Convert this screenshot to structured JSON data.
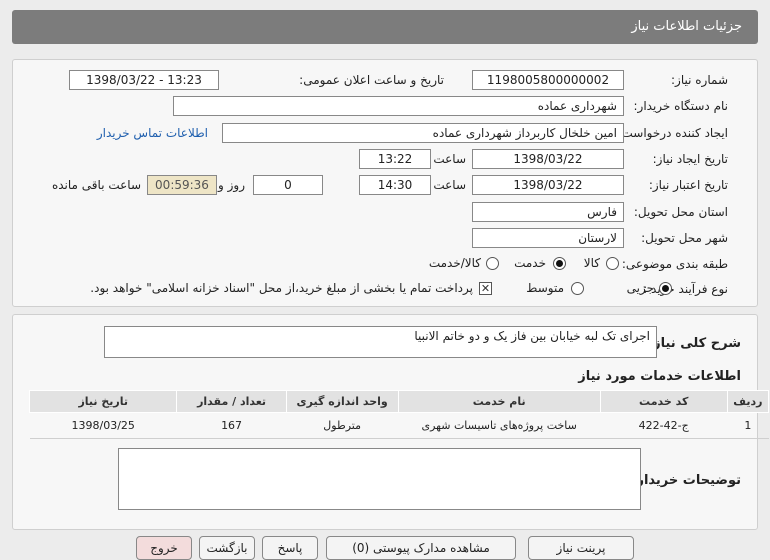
{
  "page_title": "جزئیات اطلاعات نیاز",
  "fields": {
    "need_number_label": "شماره نیاز:",
    "need_number": "1198005800000002",
    "announce_label": "تاریخ و ساعت اعلان عمومی:",
    "announce_value": "1398/03/22 - 13:23",
    "buyer_org_label": "نام دستگاه خریدار:",
    "buyer_org": "شهرداری عماده",
    "creator_label": "ایجاد کننده درخواست:",
    "creator": "امین خلخال کاربرداز شهرداری عماده",
    "contact_link": "اطلاعات تماس خریدار",
    "created_date_label": "تاریخ ایجاد نیاز:",
    "created_date": "1398/03/22",
    "time_label": "ساعت",
    "created_time": "13:22",
    "validity_label": "تاریخ اعتبار نیاز:",
    "validity_date": "1398/03/22",
    "validity_time": "14:30",
    "days_value": "0",
    "days_label": "روز و",
    "remaining_time": "00:59:36",
    "remaining_label": "ساعت باقی مانده",
    "province_label": "استان محل تحویل:",
    "province": "فارس",
    "city_label": "شهر محل تحویل:",
    "city": "لارستان",
    "category_label": "طبقه بندی موضوعی:",
    "category_options": [
      "کالا",
      "خدمت",
      "کالا/خدمت"
    ],
    "category_selected": "خدمت",
    "purchase_label": "نوع فرآیند خرید :",
    "purchase_options": [
      "جزیی",
      "متوسط"
    ],
    "purchase_selected": "جزیی",
    "payment_note": "پرداخت تمام یا بخشی از مبلغ خرید،از محل \"اسناد خزانه اسلامی\" خواهد بود."
  },
  "summary": {
    "label": "شرح کلی نیاز:",
    "value": "اجرای تک لبه خیابان بین فاز یک و دو خاتم الانبیا"
  },
  "services": {
    "heading": "اطلاعات خدمات مورد نیاز",
    "columns": [
      "ردیف",
      "کد خدمت",
      "نام خدمت",
      "واحد اندازه گیری",
      "تعداد / مقدار",
      "تاریخ نیاز"
    ],
    "rows": [
      [
        "1",
        "ج-42-422",
        "ساخت پروژه‌های تاسیسات شهری",
        "مترطول",
        "167",
        "1398/03/25"
      ]
    ]
  },
  "buyer_notes_label": "توضیحات خریدار:",
  "buttons": {
    "print": "پرینت نیاز",
    "view_docs": "مشاهده مدارک پیوستی (0)",
    "reply": "پاسخ",
    "back": "بازگشت",
    "exit": "خروج"
  }
}
